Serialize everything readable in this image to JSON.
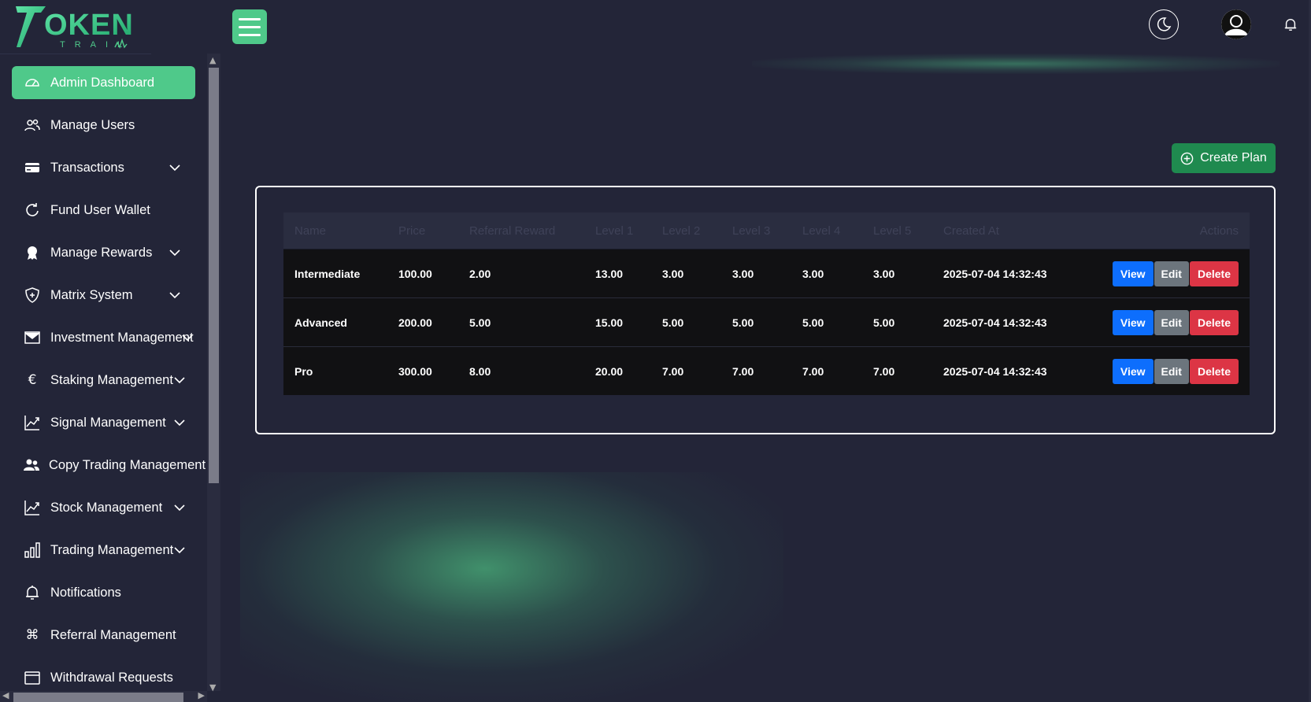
{
  "brand": {
    "logo_text": "TOKEN",
    "logo_sub": "TRAIL"
  },
  "sidebar": {
    "items": [
      {
        "label": "Admin Dashboard",
        "icon": "dashboard-icon",
        "active": true,
        "expandable": false
      },
      {
        "label": "Manage Users",
        "icon": "users-icon",
        "active": false,
        "expandable": false
      },
      {
        "label": "Transactions",
        "icon": "card-icon",
        "active": false,
        "expandable": true
      },
      {
        "label": "Fund User Wallet",
        "icon": "refresh-icon",
        "active": false,
        "expandable": false
      },
      {
        "label": "Manage Rewards",
        "icon": "award-icon",
        "active": false,
        "expandable": true
      },
      {
        "label": "Matrix System",
        "icon": "shield-icon",
        "active": false,
        "expandable": true
      },
      {
        "label": "Investment Management",
        "icon": "envelope-icon",
        "active": false,
        "expandable": true
      },
      {
        "label": "Staking Management",
        "icon": "euro-icon",
        "active": false,
        "expandable": true
      },
      {
        "label": "Signal Management",
        "icon": "graph-up-icon",
        "active": false,
        "expandable": true
      },
      {
        "label": "Copy Trading Management",
        "icon": "people-icon",
        "active": false,
        "expandable": true
      },
      {
        "label": "Stock Management",
        "icon": "graph-up-icon",
        "active": false,
        "expandable": true
      },
      {
        "label": "Trading Management",
        "icon": "bar-chart-icon",
        "active": false,
        "expandable": true
      },
      {
        "label": "Notifications",
        "icon": "bell-icon",
        "active": false,
        "expandable": false
      },
      {
        "label": "Referral Management",
        "icon": "command-icon",
        "active": false,
        "expandable": false
      },
      {
        "label": "Withdrawal Requests",
        "icon": "window-icon",
        "active": false,
        "expandable": false
      }
    ]
  },
  "header": {
    "menu_icon": "hamburger-icon",
    "theme_icon": "moon-icon",
    "avatar_icon": "user-avatar-icon",
    "bell_icon": "bell-icon"
  },
  "main": {
    "create_button": "Create Plan",
    "table": {
      "columns": [
        "Name",
        "Price",
        "Referral Reward",
        "Level 1",
        "Level 2",
        "Level 3",
        "Level 4",
        "Level 5",
        "Created At",
        "Actions"
      ],
      "rows": [
        [
          "Intermediate",
          "100.00",
          "2.00",
          "13.00",
          "3.00",
          "3.00",
          "3.00",
          "3.00",
          "2025-07-04 14:32:43"
        ],
        [
          "Advanced",
          "200.00",
          "5.00",
          "15.00",
          "5.00",
          "5.00",
          "5.00",
          "5.00",
          "2025-07-04 14:32:43"
        ],
        [
          "Pro",
          "300.00",
          "8.00",
          "20.00",
          "7.00",
          "7.00",
          "7.00",
          "7.00",
          "2025-07-04 14:32:43"
        ]
      ],
      "actions": {
        "view": "View",
        "edit": "Edit",
        "delete": "Delete"
      }
    }
  },
  "colors": {
    "background": "#232538",
    "accent": "#4fc98a",
    "create": "#1f8a4f",
    "view": "#0d6efd",
    "edit": "#6c757d",
    "delete": "#dc3545"
  }
}
